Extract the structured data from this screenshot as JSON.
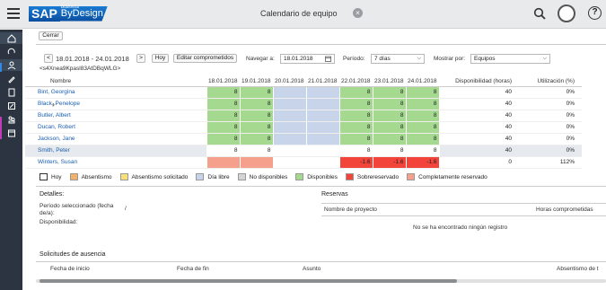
{
  "header": {
    "logo_sap": "SAP",
    "logo_business": "Business",
    "logo_bydesign": "ByDesign",
    "title": "Calendario de equipo",
    "close_glyph": "×",
    "help_glyph": "?"
  },
  "toolbar": {
    "close_label": "Cerrar",
    "prev_glyph": "<",
    "next_glyph": ">",
    "date_range": "18.01.2018 - 24.01.2018",
    "today_label": "Hoy",
    "edit_label": "Editar comprometidos",
    "navigate_label": "Navegar a:",
    "navigate_value": "18.01.2018",
    "period_label": "Período:",
    "period_value": "7 días",
    "show_by_label": "Mostrar por:",
    "show_by_value": "Equipos",
    "id_text": "<s4Xnea9Kpasl83AtDBqWLG>"
  },
  "grid": {
    "col_name": "Nombre",
    "dates": [
      "18.01.2018",
      "19.01.2018",
      "20.01.2018",
      "21.01.2018",
      "22.01.2018",
      "23.01.2018",
      "24.01.2018"
    ],
    "col_avail": "Disponibilidad (horas)",
    "col_util": "Utilización (%)",
    "rows": [
      {
        "name": "Bint, Georgina",
        "cells": [
          "8",
          "8",
          "",
          "",
          "8",
          "8",
          "8"
        ],
        "colors": [
          "g",
          "g",
          "b",
          "b",
          "g",
          "g",
          "g"
        ],
        "avail": "40",
        "util": "0%"
      },
      {
        "name": "Black, Penelope",
        "cells": [
          "8",
          "8",
          "",
          "",
          "8",
          "8",
          "8"
        ],
        "colors": [
          "g",
          "g",
          "b",
          "b",
          "g",
          "g",
          "g"
        ],
        "avail": "40",
        "util": "0%"
      },
      {
        "name": "Butler, Albert",
        "cells": [
          "8",
          "8",
          "",
          "",
          "8",
          "8",
          "8"
        ],
        "colors": [
          "g",
          "g",
          "b",
          "b",
          "g",
          "g",
          "g"
        ],
        "avail": "40",
        "util": "0%"
      },
      {
        "name": "Ducan, Robert",
        "cells": [
          "8",
          "8",
          "",
          "",
          "8",
          "8",
          "8"
        ],
        "colors": [
          "g",
          "g",
          "b",
          "b",
          "g",
          "g",
          "g"
        ],
        "avail": "40",
        "util": "0%"
      },
      {
        "name": "Jackson, Jane",
        "cells": [
          "8",
          "8",
          "",
          "",
          "8",
          "8",
          "8"
        ],
        "colors": [
          "g",
          "g",
          "b",
          "b",
          "g",
          "g",
          "g"
        ],
        "avail": "40",
        "util": "0%"
      },
      {
        "name": "Smith, Peter",
        "cells": [
          "8",
          "8",
          "",
          "",
          "8",
          "8",
          "8"
        ],
        "colors": [
          "g",
          "g",
          "b",
          "b",
          "g",
          "g",
          "g"
        ],
        "avail": "40",
        "util": "0%"
      },
      {
        "name": "Winters, Susan",
        "cells": [
          "",
          "",
          "",
          "",
          "-1.6",
          "-1.6",
          "-1.6"
        ],
        "colors": [
          "s",
          "s",
          "w",
          "w",
          "r",
          "r",
          "r"
        ],
        "avail": "0",
        "util": "112%"
      }
    ]
  },
  "legend": [
    {
      "label": "Hoy",
      "color": "#ffffff"
    },
    {
      "label": "Absentismo",
      "color": "#f0b26b"
    },
    {
      "label": "Absentismo solicitado",
      "color": "#f7e07a"
    },
    {
      "label": "Día libre",
      "color": "#c8d4ea"
    },
    {
      "label": "No disponibles",
      "color": "#d2d4d6"
    },
    {
      "label": "Disponibles",
      "color": "#a5d98f"
    },
    {
      "label": "Sobrereservado",
      "color": "#f2443a"
    },
    {
      "label": "Completamente reservado",
      "color": "#f5a08c"
    }
  ],
  "details": {
    "title": "Detalles:",
    "period_label": "Período seleccionado (fecha de/a):",
    "period_value": "/",
    "availability_label": "Disponibilidad:"
  },
  "reservations": {
    "title": "Reservas",
    "col_project": "Nombre de proyecto",
    "col_hours": "Horas comprometidas",
    "empty": "No se ha encontrado ningún registro"
  },
  "absence": {
    "title": "Solicitudes de ausencia",
    "col_start": "Fecha de inicio",
    "col_end": "Fecha de fin",
    "col_subject": "Asunto",
    "col_absence": "Absentismo de t"
  }
}
